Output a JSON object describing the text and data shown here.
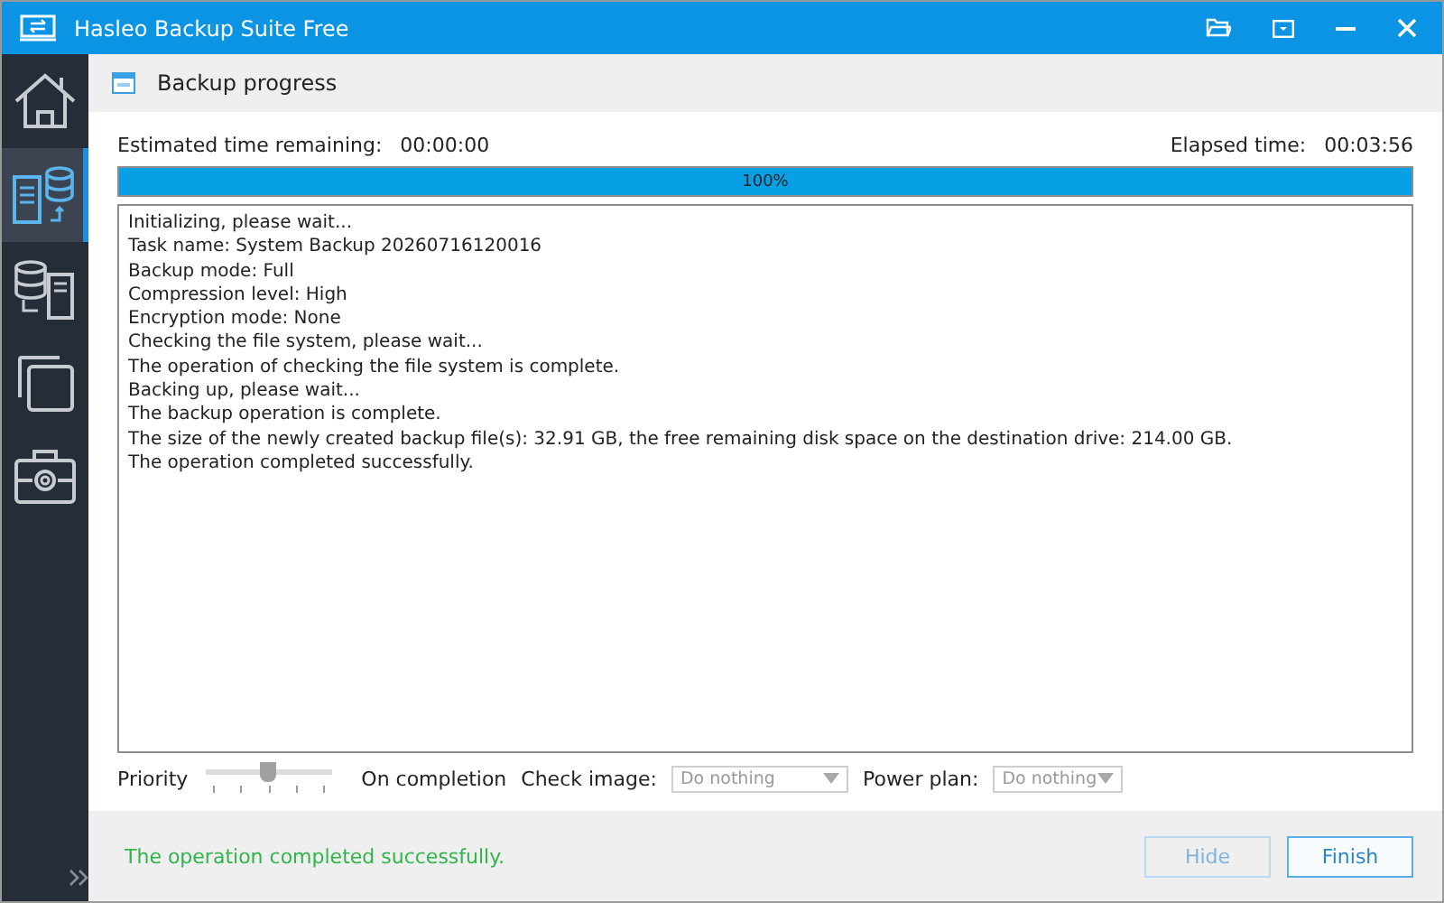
{
  "window": {
    "title": "Hasleo Backup Suite Free"
  },
  "sidebar": {
    "items": [
      {
        "kind": "home",
        "selected": false
      },
      {
        "kind": "backup",
        "selected": true
      },
      {
        "kind": "restore",
        "selected": false
      },
      {
        "kind": "clone",
        "selected": false
      },
      {
        "kind": "tools",
        "selected": false
      }
    ]
  },
  "header": {
    "title": "Backup progress"
  },
  "estimated": {
    "label": "Estimated time remaining:",
    "value": "00:00:00"
  },
  "elapsed": {
    "label": "Elapsed time:",
    "value": "00:03:56"
  },
  "progress": {
    "level": 1,
    "text": "100%"
  },
  "log": [
    "Initializing, please wait...",
    "Task name: System Backup 20260716120016",
    "Backup mode: Full",
    "Compression level: High",
    "Encryption mode: None",
    "Checking the file system, please wait...",
    "The operation of checking the file system is complete.",
    "Backing up, please wait...",
    "The backup operation is complete.",
    "The size of the newly created backup file(s): 32.91 GB, the free remaining disk space on the destination drive: 214.00 GB.",
    "The operation completed successfully."
  ],
  "priority": {
    "label": "Priority",
    "level": 0.5
  },
  "on_completion": {
    "label": "On completion"
  },
  "check_image": {
    "label": "Check image:",
    "value": "Do nothing",
    "disabled": true
  },
  "power_plan": {
    "label": "Power plan:",
    "value": "Do nothing",
    "disabled": true
  },
  "status": "The operation completed successfully.",
  "buttons": [
    {
      "label": "Hide",
      "disabled": true
    },
    {
      "label": "Finish",
      "disabled": false
    }
  ]
}
